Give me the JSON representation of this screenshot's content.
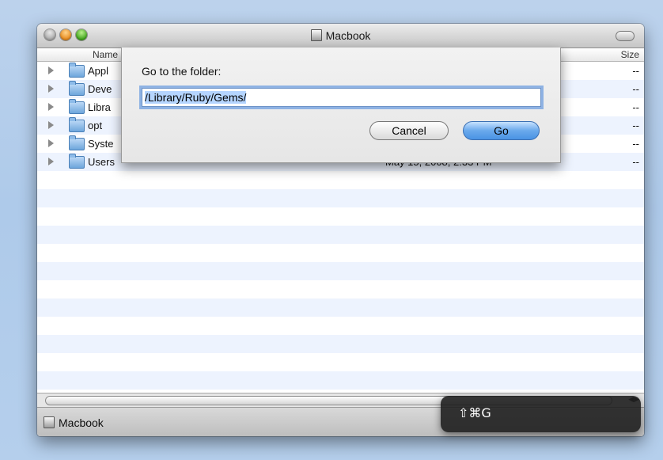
{
  "window": {
    "title": "Macbook"
  },
  "columns": {
    "name": "Name",
    "size": "Size"
  },
  "rows": [
    {
      "name": "Appl",
      "date": "",
      "size": "--"
    },
    {
      "name": "Deve",
      "date": "",
      "size": "--"
    },
    {
      "name": "Libra",
      "date": "",
      "size": "--"
    },
    {
      "name": "opt",
      "date": "",
      "size": "--"
    },
    {
      "name": "Syste",
      "date": "",
      "size": "--"
    },
    {
      "name": "Users",
      "date": "May 15, 2008, 2:33 PM",
      "size": "--"
    }
  ],
  "dialog": {
    "prompt": "Go to the folder:",
    "path_value": "/Library/Ruby/Gems/",
    "cancel_label": "Cancel",
    "go_label": "Go"
  },
  "status": {
    "label": "Macbook"
  },
  "shortcut": {
    "keys": "⇧⌘G"
  }
}
